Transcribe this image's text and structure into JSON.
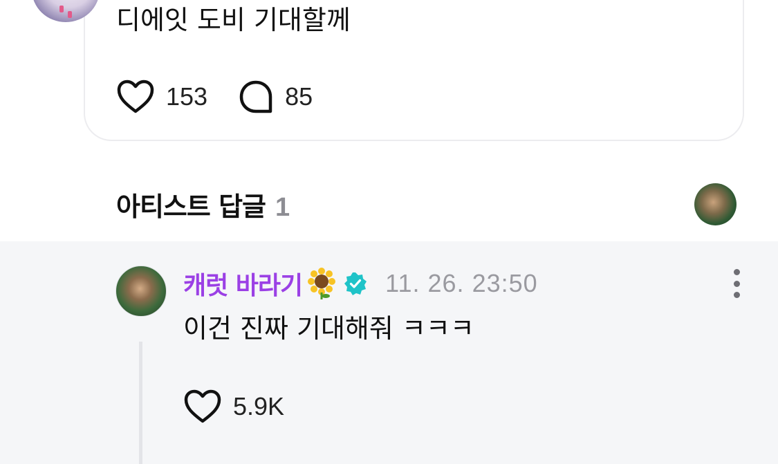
{
  "post": {
    "text": "디에잇 도비 기대할께",
    "likes": "153",
    "comments": "85"
  },
  "artist_replies": {
    "title": "아티스트 답글",
    "count": "1"
  },
  "reply": {
    "author": "캐럿 바라기",
    "author_emoji": "sunflower",
    "verified": true,
    "timestamp": "11. 26. 23:50",
    "text": "이건 진짜 기대해줘 ㅋㅋㅋ",
    "likes": "5.9K"
  },
  "colors": {
    "author_name": "#9b40e5",
    "verified_badge": "#1fc3c8",
    "reply_background": "#f5f6f8",
    "muted_text": "#9a9aa0"
  },
  "icons": [
    "heart-icon",
    "comment-bubble-icon",
    "verified-badge-icon",
    "sunflower-emoji",
    "more-vertical-icon"
  ]
}
